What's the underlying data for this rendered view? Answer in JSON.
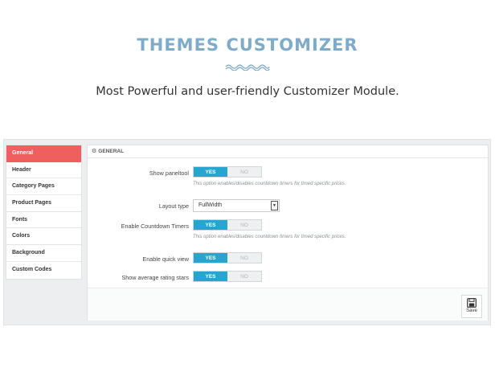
{
  "hero": {
    "title": "THEMES CUSTOMIZER",
    "subtitle": "Most Powerful and user-friendly Customizer Module."
  },
  "sidebar": {
    "items": [
      {
        "label": "General",
        "active": true
      },
      {
        "label": "Header"
      },
      {
        "label": "Category Pages"
      },
      {
        "label": "Product Pages"
      },
      {
        "label": "Fonts"
      },
      {
        "label": "Colors"
      },
      {
        "label": "Background"
      },
      {
        "label": "Custom Codes"
      }
    ]
  },
  "panel": {
    "heading": "GENERAL",
    "heading_icon": "gear-icon",
    "rows": {
      "paneltool": {
        "label": "Show paneltool",
        "yes": "YES",
        "no": "NO",
        "value": "YES",
        "help": "This option enables/disables countdown timers for timed specific prices."
      },
      "layout": {
        "label": "Layout type",
        "value": "FullWidth"
      },
      "countdown": {
        "label": "Enable Countdown Timers",
        "yes": "YES",
        "no": "NO",
        "value": "YES",
        "help": "This option enables/disables countdown timers for timed specific prices."
      },
      "quickview": {
        "label": "Enable quick view",
        "yes": "YES",
        "no": "NO",
        "value": "YES"
      },
      "rating": {
        "label": "Show average rating stars",
        "yes": "YES",
        "no": "NO",
        "value": "YES"
      }
    },
    "save_label": "Save"
  },
  "colors": {
    "accent": "#25a5d0",
    "active_tab": "#ef5f5f",
    "title": "#7eabc9"
  }
}
